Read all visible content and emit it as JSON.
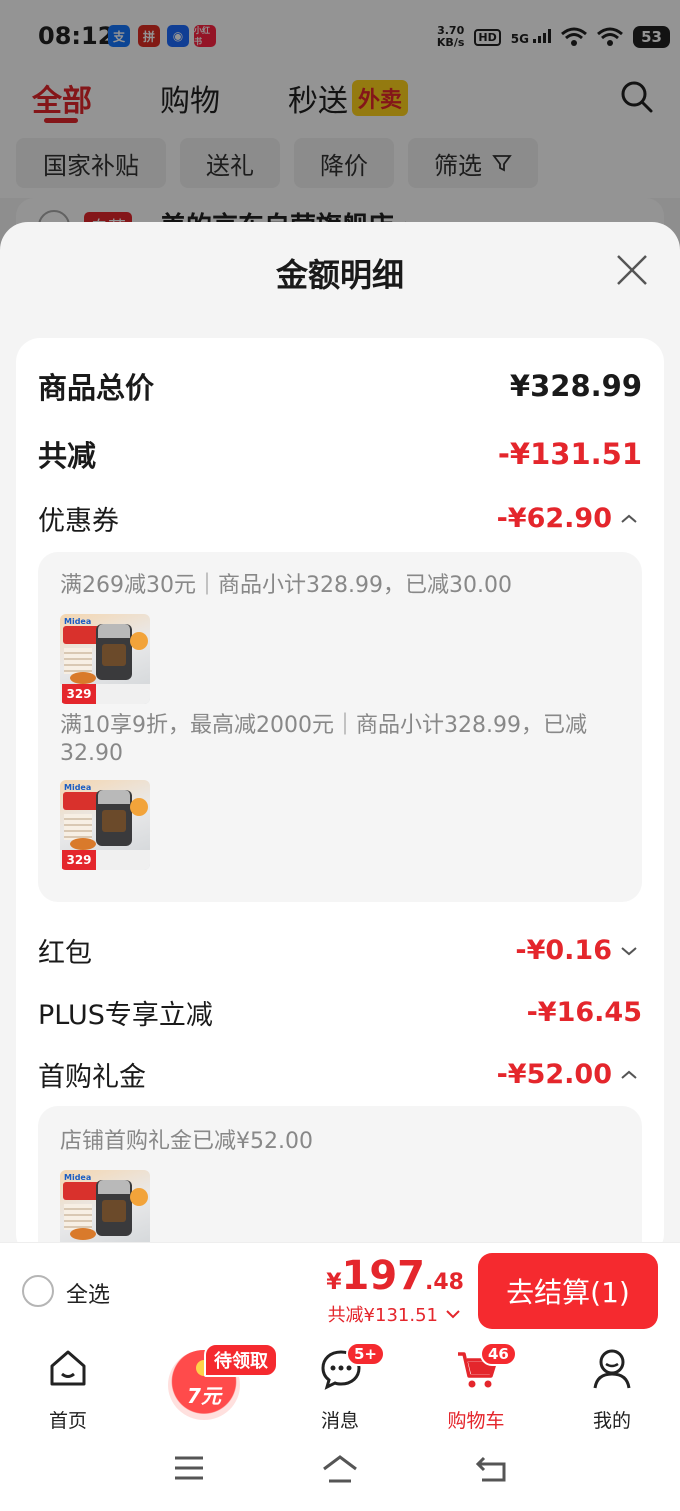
{
  "status_bar": {
    "time": "08:12",
    "app_icons": [
      "alipay-icon",
      "pdd-icon",
      "bot-icon",
      "xiaohongshu-icon"
    ],
    "app_icon_glyphs": [
      "支",
      "拼",
      "◉",
      "小红书"
    ],
    "speed_value": "3.70",
    "speed_unit": "KB/s",
    "hd": "HD",
    "network": "5G",
    "battery": "53"
  },
  "header": {
    "tabs": [
      {
        "label": "全部",
        "active": true
      },
      {
        "label": "购物",
        "active": false
      },
      {
        "label": "秒送",
        "active": false
      }
    ],
    "takeout_badge": "外卖"
  },
  "filters": [
    {
      "label": "国家补贴"
    },
    {
      "label": "送礼"
    },
    {
      "label": "降价"
    },
    {
      "label": "筛选"
    }
  ],
  "shop_peek": {
    "tag": "自营",
    "name": "美的京东自营旗舰店 ›"
  },
  "sheet": {
    "title": "金额明细",
    "total_label": "商品总价",
    "total_value": "¥328.99",
    "reduce_label": "共减",
    "reduce_value": "-¥131.51",
    "coupon_label": "优惠券",
    "coupon_value": "-¥62.90",
    "coupon_details": [
      {
        "text": "满269减30元｜商品小计328.99，已减30.00",
        "thumb_price": "329"
      },
      {
        "text": "满10享9折，最高减2000元｜商品小计328.99，已减32.90",
        "thumb_price": "329"
      }
    ],
    "redpacket_label": "红包",
    "redpacket_value": "-¥0.16",
    "plus_label": "PLUS专享立减",
    "plus_value": "-¥16.45",
    "firstbuy_label": "首购礼金",
    "firstbuy_value": "-¥52.00",
    "firstbuy_detail": "店铺首购礼金已减¥52.00",
    "thumb_brand": "Midea"
  },
  "checkout": {
    "select_all": "全选",
    "price_symbol": "¥",
    "price_int": "197",
    "price_dec": ".48",
    "saved": "共减¥131.51",
    "button": "去结算(1)"
  },
  "bottom_nav": {
    "items": [
      {
        "label": "首页"
      },
      {
        "label": ""
      },
      {
        "label": "消息",
        "badge": "5+"
      },
      {
        "label": "购物车",
        "badge": "46"
      },
      {
        "label": "我的"
      }
    ],
    "promo_badge": "待领取",
    "promo_text": "7元"
  },
  "colors": {
    "accent": "#e4262c",
    "button": "#f52a2f",
    "takeout": "#ffd21c"
  }
}
